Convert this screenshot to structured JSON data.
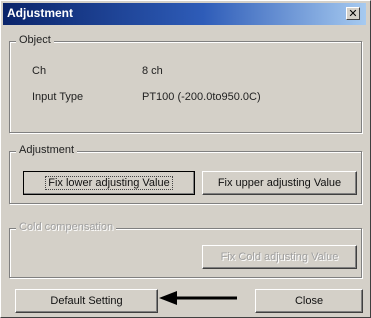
{
  "window": {
    "title": "Adjustment"
  },
  "object_group": {
    "legend": "Object",
    "ch_label": "Ch",
    "ch_value": "8 ch",
    "input_type_label": "Input Type",
    "input_type_value": "PT100 (-200.0to950.0C)"
  },
  "adjustment_group": {
    "legend": "Adjustment",
    "fix_lower_label": "Fix lower adjusting Value",
    "fix_upper_label": "Fix upper adjusting Value"
  },
  "compensation_group": {
    "legend": "Cold compensation",
    "fix_button_label": "Fix Cold adjusting Value"
  },
  "footer": {
    "default_setting_label": "Default Setting",
    "close_label": "Close"
  },
  "colors": {
    "dialog_face": "#d4d0c8",
    "titlebar_start": "#0a246a",
    "titlebar_end": "#a6caf0"
  }
}
